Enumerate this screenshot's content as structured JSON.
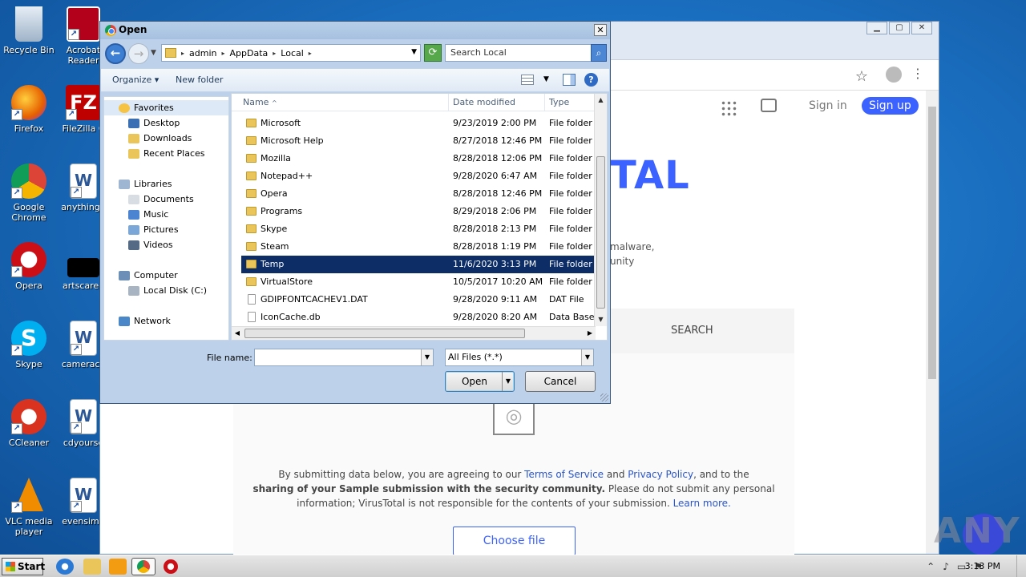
{
  "desktop": {
    "icons": [
      {
        "label": "Recycle Bin",
        "icon": "recycle-bin-icon",
        "color": "#c9d7e6"
      },
      {
        "label": "Acrobat Reader",
        "icon": "acrobat-icon",
        "color": "#b3001b"
      },
      {
        "label": "Firefox",
        "icon": "firefox-icon",
        "color": "#e66000"
      },
      {
        "label": "FileZilla C",
        "icon": "filezilla-icon",
        "color": "#bf0000"
      },
      {
        "label": "Google Chrome",
        "icon": "chrome-icon",
        "color": "#4285f4"
      },
      {
        "label": "anythingh",
        "icon": "word-doc-icon",
        "color": "#2b5797"
      },
      {
        "label": "Opera",
        "icon": "opera-icon",
        "color": "#cc0f16"
      },
      {
        "label": "artscaree",
        "icon": "black-file-icon",
        "color": "#000000"
      },
      {
        "label": "Skype",
        "icon": "skype-icon",
        "color": "#00aff0"
      },
      {
        "label": "cameraca",
        "icon": "word-doc-icon",
        "color": "#2b5797"
      },
      {
        "label": "CCleaner",
        "icon": "ccleaner-icon",
        "color": "#d9331f"
      },
      {
        "label": "cdyourse",
        "icon": "word-doc-icon",
        "color": "#2b5797"
      },
      {
        "label": "VLC media player",
        "icon": "vlc-icon",
        "color": "#f08c00"
      },
      {
        "label": "evensimp",
        "icon": "word-doc-icon",
        "color": "#2b5797"
      }
    ]
  },
  "browser": {
    "header": {
      "sign_in": "Sign in",
      "sign_up": "Sign up"
    },
    "logo_fragment": "TAL",
    "desc_line1": "malware,",
    "desc_line2": "unity",
    "tab_search": "SEARCH",
    "terms": {
      "p1": "By submitting data below, you are agreeing to our ",
      "tos": "Terms of Service",
      "and": " and ",
      "privacy": "Privacy Policy",
      "p2": ", and to the",
      "bold": "sharing of your Sample submission with the security community.",
      "p3": " Please do not submit any personal",
      "p4": "information; VirusTotal is not responsible for the contents of your submission. ",
      "learn": "Learn more."
    },
    "choose_file": "Choose file",
    "watermark": "ANY RUN"
  },
  "dialog": {
    "title": "Open",
    "close": "✕",
    "breadcrumbs": [
      "admin",
      "AppData",
      "Local"
    ],
    "search_placeholder": "Search Local",
    "organize": "Organize",
    "new_folder": "New folder",
    "nav": {
      "favorites": "Favorites",
      "desktop": "Desktop",
      "downloads": "Downloads",
      "recent": "Recent Places",
      "libraries": "Libraries",
      "documents": "Documents",
      "music": "Music",
      "pictures": "Pictures",
      "videos": "Videos",
      "computer": "Computer",
      "local_disk": "Local Disk (C:)",
      "network": "Network"
    },
    "columns": {
      "name": "Name",
      "date": "Date modified",
      "type": "Type"
    },
    "files": [
      {
        "name": "Microsoft",
        "date": "9/23/2019 2:00 PM",
        "type": "File folder",
        "kind": "folder"
      },
      {
        "name": "Microsoft Help",
        "date": "8/27/2018 12:46 PM",
        "type": "File folder",
        "kind": "folder"
      },
      {
        "name": "Mozilla",
        "date": "8/28/2018 12:06 PM",
        "type": "File folder",
        "kind": "folder"
      },
      {
        "name": "Notepad++",
        "date": "9/28/2020 6:47 AM",
        "type": "File folder",
        "kind": "folder"
      },
      {
        "name": "Opera",
        "date": "8/28/2018 12:46 PM",
        "type": "File folder",
        "kind": "folder"
      },
      {
        "name": "Programs",
        "date": "8/29/2018 2:06 PM",
        "type": "File folder",
        "kind": "folder"
      },
      {
        "name": "Skype",
        "date": "8/28/2018 2:13 PM",
        "type": "File folder",
        "kind": "folder"
      },
      {
        "name": "Steam",
        "date": "8/28/2018 1:19 PM",
        "type": "File folder",
        "kind": "folder"
      },
      {
        "name": "Temp",
        "date": "11/6/2020 3:13 PM",
        "type": "File folder",
        "kind": "folder",
        "selected": true
      },
      {
        "name": "VirtualStore",
        "date": "10/5/2017 10:20 AM",
        "type": "File folder",
        "kind": "folder"
      },
      {
        "name": "GDIPFONTCACHEV1.DAT",
        "date": "9/28/2020 9:11 AM",
        "type": "DAT File",
        "kind": "file"
      },
      {
        "name": "IconCache.db",
        "date": "9/28/2020 8:20 AM",
        "type": "Data Base File",
        "kind": "file"
      }
    ],
    "file_name_label": "File name:",
    "file_name_value": "",
    "file_type": "All Files (*.*)",
    "open_btn": "Open",
    "cancel_btn": "Cancel"
  },
  "taskbar": {
    "start": "Start",
    "clock": "3:13 PM"
  }
}
